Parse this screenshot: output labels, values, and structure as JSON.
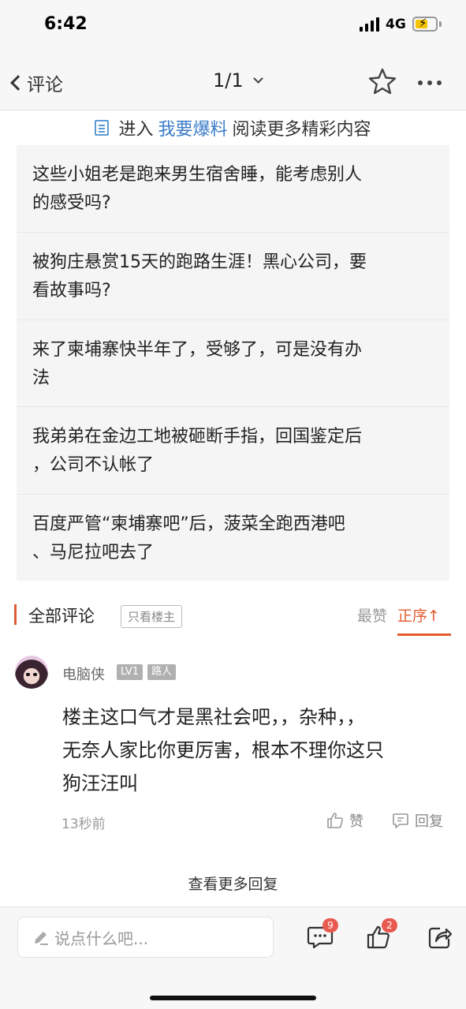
{
  "status_bar": {
    "time": "6:42",
    "network": "4G"
  },
  "nav": {
    "back_label": "评论",
    "page_indicator": "1/1"
  },
  "promo": {
    "prefix": "进入",
    "link": "我要爆料",
    "suffix": "阅读更多精彩内容"
  },
  "related": [
    {
      "line1": "这些小姐老是跑来男生宿舍睡，能考虑别人",
      "line2": "的感受吗?"
    },
    {
      "line1": "被狗庄悬赏15天的跑路生涯！黑心公司，要",
      "line2": "看故事吗?"
    },
    {
      "line1": "来了柬埔寨快半年了，受够了，可是没有办",
      "line2": "法"
    },
    {
      "line1": "我弟弟在金边工地被砸断手指，回国鉴定后",
      "line2": "，公司不认帐了"
    },
    {
      "line1": "百度严管“柬埔寨吧”后，菠菜全跑西港吧",
      "line2": "、马尼拉吧去了"
    }
  ],
  "comments_header": {
    "title": "全部评论",
    "only_op": "只看楼主",
    "sort_hot": "最赞",
    "sort_order": "正序↑"
  },
  "comment": {
    "username": "电脑侠",
    "level": "LV1",
    "role": "路人",
    "lines": [
      "楼主这口气才是黑社会吧，，杂种，，",
      "无奈人家比你更厉害，根本不理你这只",
      "狗汪汪叫"
    ],
    "time": "13秒前",
    "like_label": "赞",
    "reply_label": "回复"
  },
  "more_replies": "查看更多回复",
  "bottom_bar": {
    "input_placeholder": "说点什么吧...",
    "comment_count": "9",
    "like_count": "2"
  },
  "colors": {
    "accent": "#e35c2f",
    "link": "#3a7bc8",
    "badge": "#e85a4f"
  }
}
